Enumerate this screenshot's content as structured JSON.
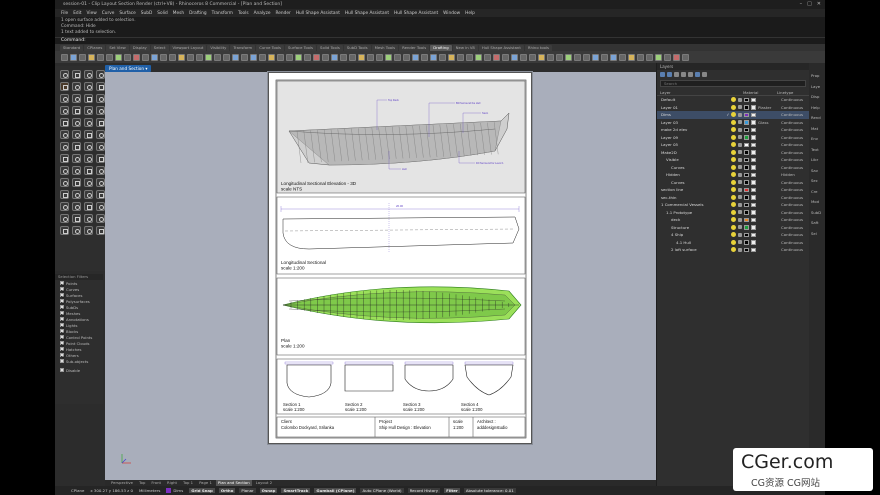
{
  "titlebar": {
    "title": "session-01 - Clip Layout Section Render (ctrl+V8) - Rhinoceros 8 Commercial - [Plan and Section]"
  },
  "menu": [
    "File",
    "Edit",
    "View",
    "Curve",
    "Surface",
    "SubD",
    "Solid",
    "Mesh",
    "Drafting",
    "Transform",
    "Tools",
    "Analyze",
    "Render",
    "Hull Shape Assistant",
    "Hull Shape Assistant",
    "Hull Shape Assistant",
    "Window",
    "Help"
  ],
  "command": {
    "history": [
      "1 open surface added to selection.",
      "Command: Hide",
      "1 text added to selection."
    ],
    "prompt": "Command:"
  },
  "toolbar_tabs": [
    "Standard",
    "CPlanes",
    "Set View",
    "Display",
    "Select",
    "Viewport Layout",
    "Visibility",
    "Transform",
    "Curve Tools",
    "Surface Tools",
    "Solid Tools",
    "SubD Tools",
    "Mesh Tools",
    "Render Tools",
    "Drafting",
    "New in V8",
    "Hull Shape Assistant",
    "Rhino tools"
  ],
  "active_toolbar_tab": "Drafting",
  "viewport": {
    "tab_label": "Plan and Section"
  },
  "drawing": {
    "v1_label1": "Longitudinal Sectional Elevation - 3D",
    "v1_label2": "scale NTS",
    "v1_callout1": "Top Deck",
    "v1_callout2": "Bill Surround the Hull",
    "v1_callout3": "Hull",
    "v1_callout4": "Stern",
    "v1_callout5": "Fill Surround for Level 1",
    "dim_top": "26.00",
    "v2_label1": "Longitudinal Sectional",
    "v2_label2": "scale 1:200",
    "v3_label1": "Plan",
    "v3_label2": "scale 1:200",
    "sections": [
      {
        "label": "Section 1",
        "scale": "scale 1:200"
      },
      {
        "label": "Section 2",
        "scale": "scale 1:200"
      },
      {
        "label": "Section 3",
        "scale": "scale 1:200"
      },
      {
        "label": "Section 4",
        "scale": "scale 1:200"
      }
    ],
    "title_block": {
      "client_label": "Client",
      "client_value": "Colombo Dockyard, Srilanka",
      "project_label": "Project",
      "project_value": "Ship Hull Design : Elevation",
      "scale_label": "scale",
      "scale_value": "1:200",
      "architect_label": "Architect :",
      "architect_value": "adddesignstudio"
    }
  },
  "selection_filters": {
    "title": "Selection Filters",
    "items": [
      {
        "label": "Points",
        "checked": true
      },
      {
        "label": "Curves",
        "checked": true
      },
      {
        "label": "Surfaces",
        "checked": true
      },
      {
        "label": "Polysurfaces",
        "checked": true
      },
      {
        "label": "SubDs",
        "checked": true
      },
      {
        "label": "Meshes",
        "checked": true
      },
      {
        "label": "Annotations",
        "checked": true
      },
      {
        "label": "Lights",
        "checked": true
      },
      {
        "label": "Blocks",
        "checked": true
      },
      {
        "label": "Control Points",
        "checked": true
      },
      {
        "label": "Point Clouds",
        "checked": true
      },
      {
        "label": "Hatches",
        "checked": true
      },
      {
        "label": "Others",
        "checked": true
      },
      {
        "label": "Sub-objects",
        "checked": false
      }
    ],
    "disable_label": "Disable"
  },
  "layers_panel": {
    "title": "Layers",
    "search_placeholder": "Search",
    "col_layer": "Layer",
    "col_material": "Material",
    "col_linetype": "Linetype",
    "rows": [
      {
        "name": "Default",
        "indent": 0,
        "color": "#000000",
        "material": "",
        "linetype": "Continuous",
        "selected": false,
        "current": false
      },
      {
        "name": "Layer 01",
        "indent": 0,
        "color": "#000000",
        "material": "Plaster",
        "linetype": "Continuous",
        "selected": false,
        "current": false
      },
      {
        "name": "Dims",
        "indent": 0,
        "color": "#7b2fbf",
        "material": "",
        "linetype": "Continuous",
        "selected": true,
        "current": true
      },
      {
        "name": "Layer 03",
        "indent": 0,
        "color": "#3a9ad9",
        "material": "Glass",
        "linetype": "Continuous",
        "selected": false,
        "current": false
      },
      {
        "name": "make 2d elev",
        "indent": 0,
        "color": "#000000",
        "material": "",
        "linetype": "Continuous",
        "selected": false,
        "current": false
      },
      {
        "name": "Layer 09",
        "indent": 0,
        "color": "#1c9c3a",
        "material": "",
        "linetype": "Continuous",
        "selected": false,
        "current": false
      },
      {
        "name": "Layer 05",
        "indent": 0,
        "color": "#ffffff",
        "material": "",
        "linetype": "Continuous",
        "selected": false,
        "current": false
      },
      {
        "name": "Make2D",
        "indent": 0,
        "color": "#000000",
        "material": "",
        "linetype": "Continuous",
        "selected": false,
        "current": false
      },
      {
        "name": "Visible",
        "indent": 1,
        "color": "#000000",
        "material": "",
        "linetype": "Continuous",
        "selected": false,
        "current": false
      },
      {
        "name": "Curves",
        "indent": 2,
        "color": "#000000",
        "material": "",
        "linetype": "Continuous",
        "selected": false,
        "current": false
      },
      {
        "name": "Hidden",
        "indent": 1,
        "color": "#000000",
        "material": "",
        "linetype": "Hidden",
        "selected": false,
        "current": false
      },
      {
        "name": "Curves",
        "indent": 2,
        "color": "#000000",
        "material": "",
        "linetype": "Continuous",
        "selected": false,
        "current": false
      },
      {
        "name": "section line",
        "indent": 0,
        "color": "#d92a2a",
        "material": "",
        "linetype": "Continuous",
        "selected": false,
        "current": false
      },
      {
        "name": "sec-thin",
        "indent": 0,
        "color": "#000000",
        "material": "",
        "linetype": "Continuous",
        "selected": false,
        "current": false
      },
      {
        "name": "1 Commercial Vessels",
        "indent": 0,
        "color": "#000000",
        "material": "",
        "linetype": "Continuous",
        "selected": false,
        "current": false
      },
      {
        "name": "1.1 Prototype",
        "indent": 1,
        "color": "#000000",
        "material": "",
        "linetype": "Continuous",
        "selected": false,
        "current": false
      },
      {
        "name": "deck",
        "indent": 2,
        "color": "#e8841f",
        "material": "",
        "linetype": "Continuous",
        "selected": false,
        "current": false
      },
      {
        "name": "Structure",
        "indent": 2,
        "color": "#1c9c3a",
        "material": "",
        "linetype": "Continuous",
        "selected": false,
        "current": false
      },
      {
        "name": "4 Ship",
        "indent": 2,
        "color": "#000000",
        "material": "",
        "linetype": "Continuous",
        "selected": false,
        "current": false
      },
      {
        "name": "4.1 Hull",
        "indent": 3,
        "color": "#000000",
        "material": "",
        "linetype": "Continuous",
        "selected": false,
        "current": false
      },
      {
        "name": "2 loft surface",
        "indent": 2,
        "color": "#000000",
        "material": "",
        "linetype": "Continuous",
        "selected": false,
        "current": false
      }
    ]
  },
  "side_tabs": [
    "Prop",
    "Laye",
    "Disp",
    "Help",
    "Rend",
    "Mat",
    "Env",
    "Text",
    "Libr",
    "Sav",
    "Sec",
    "Cre",
    "Mod",
    "SubD",
    "Saft",
    "Sel"
  ],
  "layout_tabs": [
    "Perspective",
    "Top",
    "Front",
    "Right",
    "Top 1",
    "Page 1",
    "Plan and Section",
    "Layout 2"
  ],
  "active_layout_tab": "Plan and Section",
  "status": {
    "cplane": "CPlane",
    "coords": "x 300.27  y 186.53  z 0",
    "units": "Millimeters",
    "layer": "Dims",
    "layer_color": "#7b2fbf",
    "toggles": [
      "Grid Snap",
      "Ortho",
      "Planar",
      "Osnap",
      "SmartTrack",
      "Gumball (CPlane)",
      "Auto CPlane (World)",
      "Record History",
      "Filter",
      "Absolute tolerance: 0.01"
    ]
  },
  "watermark": {
    "line1": "CGer.com",
    "line2": "CG资源 CG网站"
  }
}
